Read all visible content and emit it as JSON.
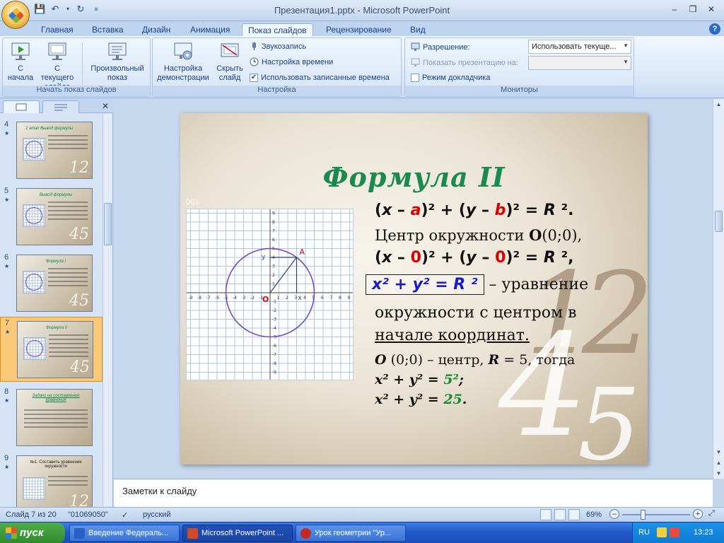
{
  "window": {
    "title": "Презентация1.pptx - Microsoft PowerPoint"
  },
  "ribbon_tabs": [
    "Главная",
    "Вставка",
    "Дизайн",
    "Анимация",
    "Показ слайдов",
    "Рецензирование",
    "Вид"
  ],
  "ribbon": {
    "start_group": {
      "label": "Начать показ слайдов",
      "from_start": "С начала",
      "from_current": "С текущего слайда",
      "custom": "Произвольный показ"
    },
    "setup_group": {
      "label": "Настройка",
      "setup_show": "Настройка демонстрации",
      "hide_slide": "Скрыть слайд",
      "record_narration": "Звукозапись",
      "rehearse_timings": "Настройка времени",
      "use_timings": "Использовать записанные времена",
      "use_timings_checked": true
    },
    "monitors_group": {
      "label": "Мониторы",
      "resolution_label": "Разрешение:",
      "resolution_value": "Использовать текуще...",
      "show_on_label": "Показать презентацию на:",
      "show_on_value": "",
      "presenter_view": "Режим докладчика",
      "presenter_view_checked": false
    }
  },
  "thumbnails": [
    {
      "num": "4",
      "title": "1 этап Вывод формулы",
      "active": false
    },
    {
      "num": "5",
      "title": "Вывод формулы",
      "active": false
    },
    {
      "num": "6",
      "title": "Формула I",
      "active": false
    },
    {
      "num": "7",
      "title": "Формула II",
      "active": true
    },
    {
      "num": "8",
      "title": "Задачи на составление уравнения",
      "active": false
    },
    {
      "num": "9",
      "title": "№1. Составить уравнение окружности",
      "active": false
    }
  ],
  "slide": {
    "title": "Формула II",
    "corner_label": "001",
    "line1": {
      "x": "x",
      "a": "a",
      "y": "y",
      "b": "b",
      "R": "R"
    },
    "line2_text": "Центр окружности ",
    "line2_O": "O",
    "line2_coords": "(0;0),",
    "line3": {
      "x": "x",
      "zero": "0",
      "y": "y",
      "R": "R"
    },
    "boxed_formula": "x² + y² = R ²",
    "line4_rest": " – уравнение",
    "line5": "окружности с центром в",
    "line6": "начале координат.",
    "line7_O": "O",
    "line7_rest": " (0;0) – центр, ",
    "line7_R": "R",
    "line7_tail": " = 5, тогда",
    "line8_left": "x² + y² = ",
    "line8_val": "5²",
    "line9_left": "x² + y² = ",
    "line9_val": "25",
    "graph": {
      "x_ticks": [
        "-9",
        "-8",
        "-7",
        "-6",
        "-5",
        "-4",
        "-3",
        "-2",
        "-1",
        "1",
        "2",
        "3",
        "4",
        "5",
        "6",
        "7",
        "8",
        "9"
      ],
      "y_ticks": [
        "9",
        "8",
        "7",
        "6",
        "5",
        "4",
        "3",
        "2",
        "1",
        "-1",
        "-2",
        "-3",
        "-4",
        "-5",
        "-6",
        "-7",
        "-8",
        "-9"
      ],
      "label_A": "A",
      "label_O": "O",
      "label_x": "x",
      "label_y": "y"
    },
    "bg_digits": [
      "1",
      "2",
      "4",
      "5"
    ]
  },
  "notes": {
    "placeholder": "Заметки к слайду"
  },
  "statusbar": {
    "slide_info": "Слайд 7 из 20",
    "theme": "\"01069050\"",
    "language": "русский",
    "zoom": "69%"
  },
  "taskbar": {
    "start": "пуск",
    "items": [
      {
        "label": "Введение Федераль...",
        "active": false,
        "color": "#2b5fcc"
      },
      {
        "label": "Microsoft PowerPoint ...",
        "active": true,
        "color": "#d04a23"
      },
      {
        "label": "Урок геометрии \"Ур...",
        "active": false,
        "color": "#c62828"
      }
    ],
    "lang": "RU",
    "time": "13:23"
  }
}
